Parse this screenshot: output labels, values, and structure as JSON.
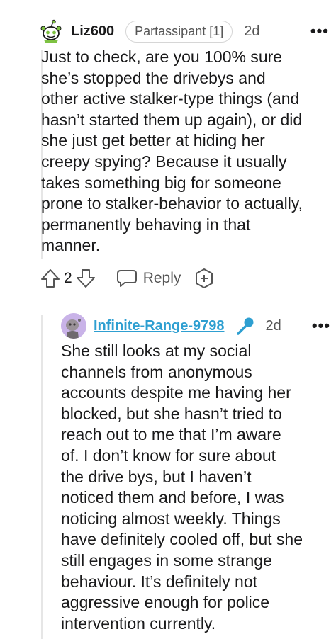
{
  "comment": {
    "username": "Liz600",
    "flair": "Partassipant [1]",
    "time": "2d",
    "more": "•••",
    "body": "Just to check, are you 100% sure\nshe’s stopped the drivebys and\nother active stalker-type things (and\nhasn’t started them up again), or did\nshe just get better at hiding her\ncreepy spying? Because it usually\ntakes something big for someone\nprone to stalker-behavior to actually,\npermanently behaving in that\nmanner.",
    "vote_count": "2",
    "reply_label": "Reply",
    "avatar_icon": "snoo-avatar-icon"
  },
  "reply": {
    "username": "Infinite-Range-9798",
    "time": "2d",
    "more": "•••",
    "body": "She still looks at my social\nchannels from anonymous\naccounts despite me having her\nblocked, but she hasn’t tried to\nreach out to me that I’m aware\nof. I don’t know for sure about\nthe drive bys, but I haven’t\nnoticed them and before, I was\nnoticing almost weekly. Things\nhave definitely cooled off, but she\nstill engages in some strange\nbehaviour. It’s definitely not\naggressive enough for police\nintervention currently.",
    "badge_icon": "microphone-icon",
    "accent": "#2e9fd1"
  }
}
